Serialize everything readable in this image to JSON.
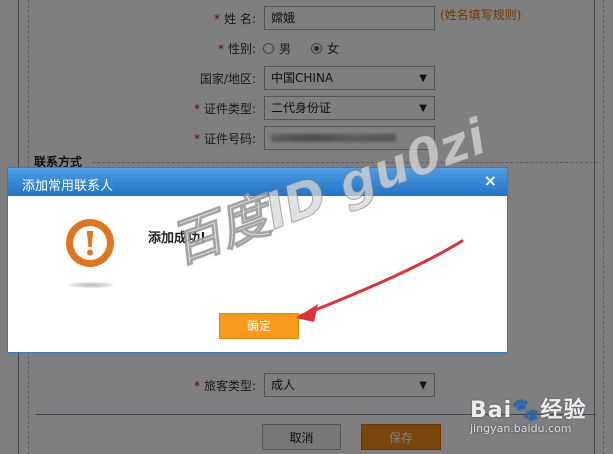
{
  "form": {
    "name_label": "姓 名:",
    "name_value": "嫦娥",
    "name_rule": "(姓名填写规则)",
    "gender_label": "性别:",
    "gender_male": "男",
    "gender_female": "女",
    "country_label": "国家/地区:",
    "country_value": "中国CHINA",
    "id_type_label": "证件类型:",
    "id_type_value": "二代身份证",
    "id_number_label": "证件号码:",
    "contact_section": "联系方式",
    "passenger_type_label": "旅客类型:",
    "passenger_type_value": "成人",
    "required_mark": "*",
    "cancel_label": "取消",
    "save_label": "保存",
    "select_arrow": "▼"
  },
  "dialog": {
    "title": "添加常用联系人",
    "close_glyph": "×",
    "message": "添加成功!",
    "ok_label": "确定",
    "icon": "warning-icon"
  },
  "watermark": {
    "text": "百度ID gu0zi"
  },
  "brand": {
    "logo_text": "Bai🐾经验",
    "site": "jingyan.baidu.com"
  },
  "colors": {
    "dialog_header": "#2f80c6",
    "ok_button": "#f79a1c",
    "save_button": "#f08a1b",
    "required": "#dd0000",
    "rule_link": "#e07000",
    "annotation_arrow": "#e0303a"
  }
}
